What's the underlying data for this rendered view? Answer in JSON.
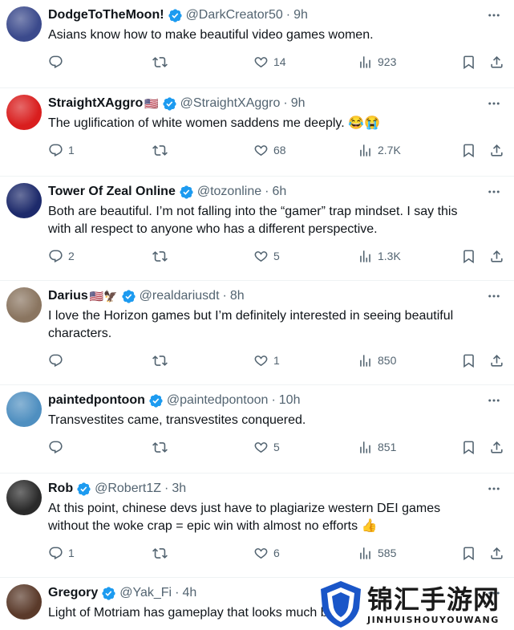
{
  "tweets": [
    {
      "name": "DodgeToTheMoon!",
      "flag": "",
      "handle": "@DarkCreator50",
      "time": "9h",
      "text": "Asians know how to make beautiful video games women.",
      "text2": "",
      "emoji": "",
      "replies": "",
      "reposts": "",
      "likes": "14",
      "views": "923",
      "avatar_color": "#3b4a8c"
    },
    {
      "name": "StraightXAggro",
      "flag": "🇺🇸",
      "handle": "@StraightXAggro",
      "time": "9h",
      "text": "The uglification of white women saddens me deeply.",
      "text2": "",
      "emoji": "😂😭",
      "replies": "1",
      "reposts": "",
      "likes": "68",
      "views": "2.7K",
      "avatar_color": "#d91e1e"
    },
    {
      "name": "Tower Of Zeal Online",
      "flag": "",
      "handle": "@tozonline",
      "time": "6h",
      "text": "Both are beautiful. I’m not falling into the “gamer” trap mindset. I say this",
      "text2": "with all respect to anyone who has a different perspective.",
      "emoji": "",
      "replies": "2",
      "reposts": "",
      "likes": "5",
      "views": "1.3K",
      "avatar_color": "#1d2a6b"
    },
    {
      "name": "Darius",
      "flag": "🇺🇸🦅",
      "handle": "@realdariusdt",
      "time": "8h",
      "text": "I love the Horizon games but I’m definitely interested in seeing beautiful",
      "text2": "characters.",
      "emoji": "",
      "replies": "",
      "reposts": "",
      "likes": "1",
      "views": "850",
      "avatar_color": "#8a7560"
    },
    {
      "name": "paintedpontoon",
      "flag": "",
      "handle": "@paintedpontoon",
      "time": "10h",
      "text": "Transvestites came, transvestites conquered.",
      "text2": "",
      "emoji": "",
      "replies": "",
      "reposts": "",
      "likes": "5",
      "views": "851",
      "avatar_color": "#4f8fc0"
    },
    {
      "name": "Rob",
      "flag": "",
      "handle": "@Robert1Z",
      "time": "3h",
      "text": "At this point, chinese devs just have to plagiarize western DEI games",
      "text2": "without the woke crap = epic win with almost no efforts",
      "emoji": "👍",
      "replies": "1",
      "reposts": "",
      "likes": "6",
      "views": "585",
      "avatar_color": "#2a2a2a"
    },
    {
      "name": "Gregory",
      "flag": "",
      "handle": "@Yak_Fi",
      "time": "4h",
      "text": "Light of Motriam has gameplay that looks much better",
      "text2": "",
      "emoji": "",
      "replies": "",
      "reposts": "",
      "likes": "",
      "views": "",
      "avatar_color": "#5a3a2a"
    }
  ],
  "watermark": {
    "title": "锦汇手游网",
    "subtitle": "JINHUISHOUYOUWANG"
  },
  "colors": {
    "verified": "#1d9bf0",
    "muted": "#536471",
    "text": "#0f1419",
    "divider": "#eff3f4"
  },
  "icons": {
    "reply": "reply-icon",
    "repost": "repost-icon",
    "like": "like-icon",
    "views": "views-icon",
    "bookmark": "bookmark-icon",
    "share": "share-icon",
    "more": "more-icon",
    "verified": "verified-badge-icon"
  }
}
